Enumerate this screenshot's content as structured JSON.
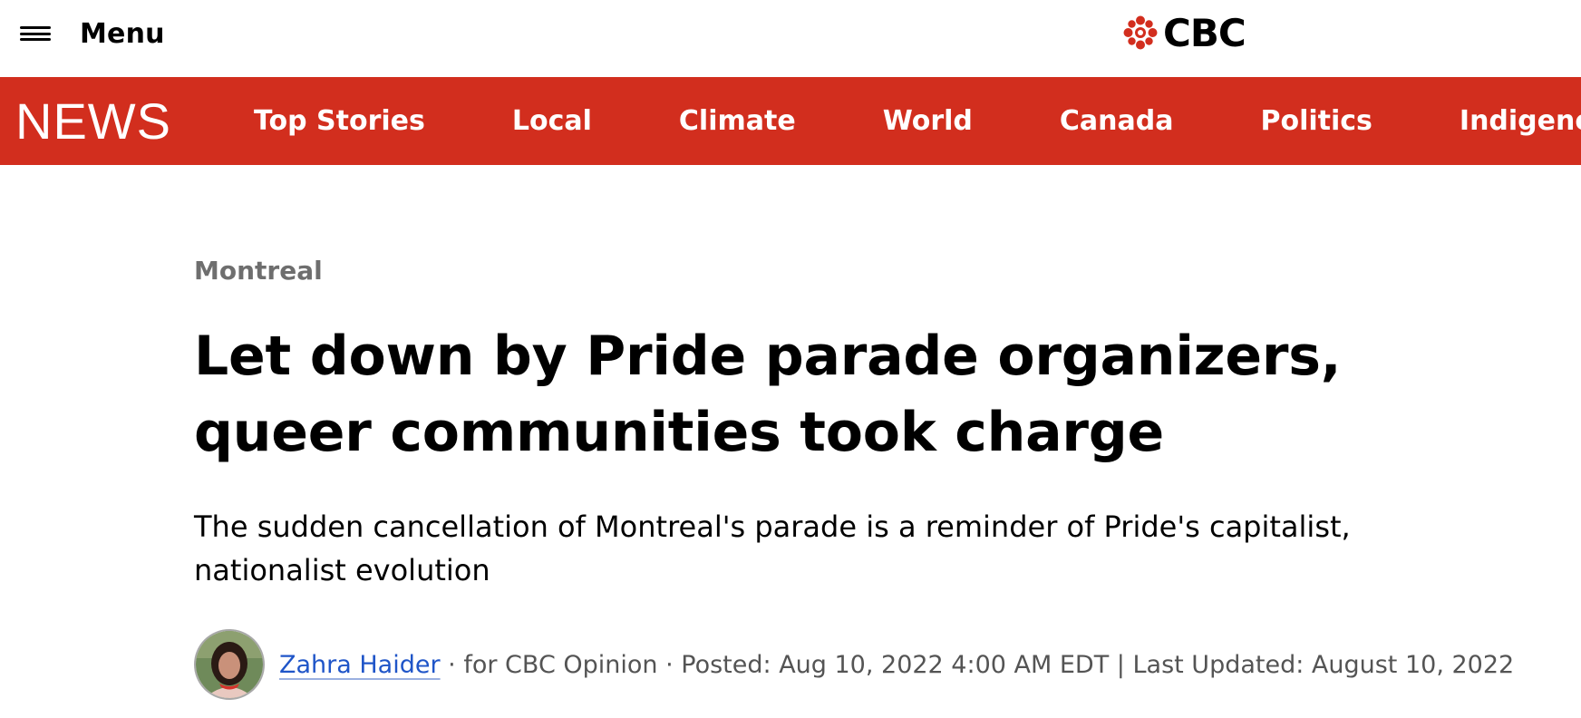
{
  "header": {
    "menu_label": "Menu",
    "brand_word": "CBC",
    "brand_color": "#d22e1e"
  },
  "navbar": {
    "section_logo": "NEWS",
    "items": [
      {
        "label": "Top Stories"
      },
      {
        "label": "Local"
      },
      {
        "label": "Climate"
      },
      {
        "label": "World"
      },
      {
        "label": "Canada"
      },
      {
        "label": "Politics"
      },
      {
        "label": "Indigenous"
      }
    ]
  },
  "article": {
    "section": "Montreal",
    "headline": "Let down by Pride parade organizers, queer communities took charge",
    "deck": "The sudden cancellation of Montreal's parade is a reminder of Pride's capitalist, nationalist evolution",
    "byline": {
      "author": "Zahra Haider",
      "meta": " · for CBC Opinion · Posted: Aug 10, 2022 4:00 AM EDT | Last Updated: August 10, 2022"
    }
  },
  "icons": {
    "menu": "hamburger-icon",
    "brand": "cbc-gem-icon",
    "avatar": "author-avatar"
  }
}
